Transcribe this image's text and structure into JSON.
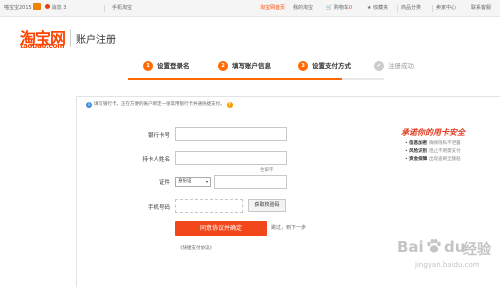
{
  "topbar": {
    "baidu_label": "喵宝宝2015",
    "tb_label": "消息",
    "mobile_label": "手机淘宝",
    "home_link": "淘宝网首页",
    "my_taobao": "我的淘宝",
    "cart": "购物车",
    "cart_count": "0",
    "favorites": "收藏夹",
    "categories": "商品分类",
    "seller_center": "卖家中心",
    "contact": "联系客服"
  },
  "header": {
    "logo_cn": "淘宝网",
    "logo_en": "taobao.com",
    "title": "账户注册"
  },
  "steps": [
    {
      "num": "1",
      "label": "设置登录名"
    },
    {
      "num": "2",
      "label": "填写账户信息"
    },
    {
      "num": "3",
      "label": "设置支付方式"
    },
    {
      "num": "✔",
      "label": "注册成功"
    }
  ],
  "tip": "填写银行卡，正在方便的账户绑定一张常用银行卡并通快捷支付。",
  "form": {
    "bank_card_label": "银行卡号",
    "holder_label": "持卡人姓名",
    "rare_char": "生僻字",
    "id_label": "证件",
    "id_type": "身份证",
    "phone_label": "手机号码",
    "get_code": "获取校验码",
    "submit": "同意协议并确定",
    "skip": "跳过，到下一步",
    "agreement": "《快捷支付协议》"
  },
  "promo": {
    "title": "承诺你的用卡安全",
    "items": [
      {
        "name": "信息加密",
        "desc": "确保隐私不泄露"
      },
      {
        "name": "风险识别",
        "desc": "阻止不明需支付"
      },
      {
        "name": "资金保障",
        "desc": "出现盗刷全额赔"
      }
    ]
  },
  "watermark": {
    "b1": "Bai",
    "b2": "du",
    "b3": "经验",
    "url": "jingyan.baidu.com"
  }
}
